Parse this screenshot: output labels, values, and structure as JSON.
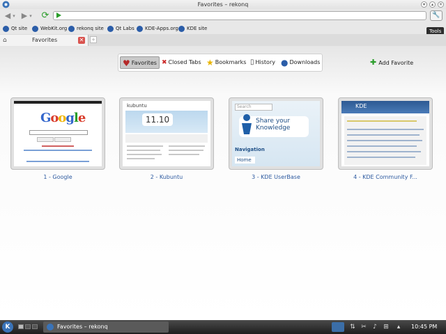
{
  "window": {
    "title": "Favorites – rekonq"
  },
  "toolbar": {
    "url_value": "",
    "tools_tooltip": "Tools"
  },
  "bookmarks": [
    {
      "label": "Qt site",
      "icon": "qt-icon"
    },
    {
      "label": "WebKit.org",
      "icon": "webkit-icon"
    },
    {
      "label": "rekonq site",
      "icon": "rekonq-icon"
    },
    {
      "label": "Qt Labs",
      "icon": "qt-icon"
    },
    {
      "label": "KDE-Apps.org",
      "icon": "kde-icon"
    },
    {
      "label": "KDE site",
      "icon": "kde-icon"
    }
  ],
  "tab": {
    "label": "Favorites"
  },
  "menu": {
    "favorites": "Favorites",
    "closed_tabs": "Closed Tabs",
    "bookmarks": "Bookmarks",
    "history": "History",
    "downloads": "Downloads"
  },
  "add_favorite": "Add Favorite",
  "thumbnails": [
    {
      "caption": "1 - Google"
    },
    {
      "caption": "2 - Kubuntu",
      "version": "11.10",
      "logo": "kubuntu"
    },
    {
      "caption": "3 - KDE UserBase",
      "search": "Search",
      "bubble": "Share your Knowledge",
      "nav": "Navigation",
      "home": "Home"
    },
    {
      "caption": "4 - KDE Community F...",
      "header": "KDE"
    }
  ],
  "taskbar": {
    "task_label": "Favorites – rekonq",
    "clock": "10:45 PM"
  },
  "colors": {
    "accent": "#2d5aa0",
    "add_green": "#2a9d2a",
    "close_red": "#d9534f"
  }
}
